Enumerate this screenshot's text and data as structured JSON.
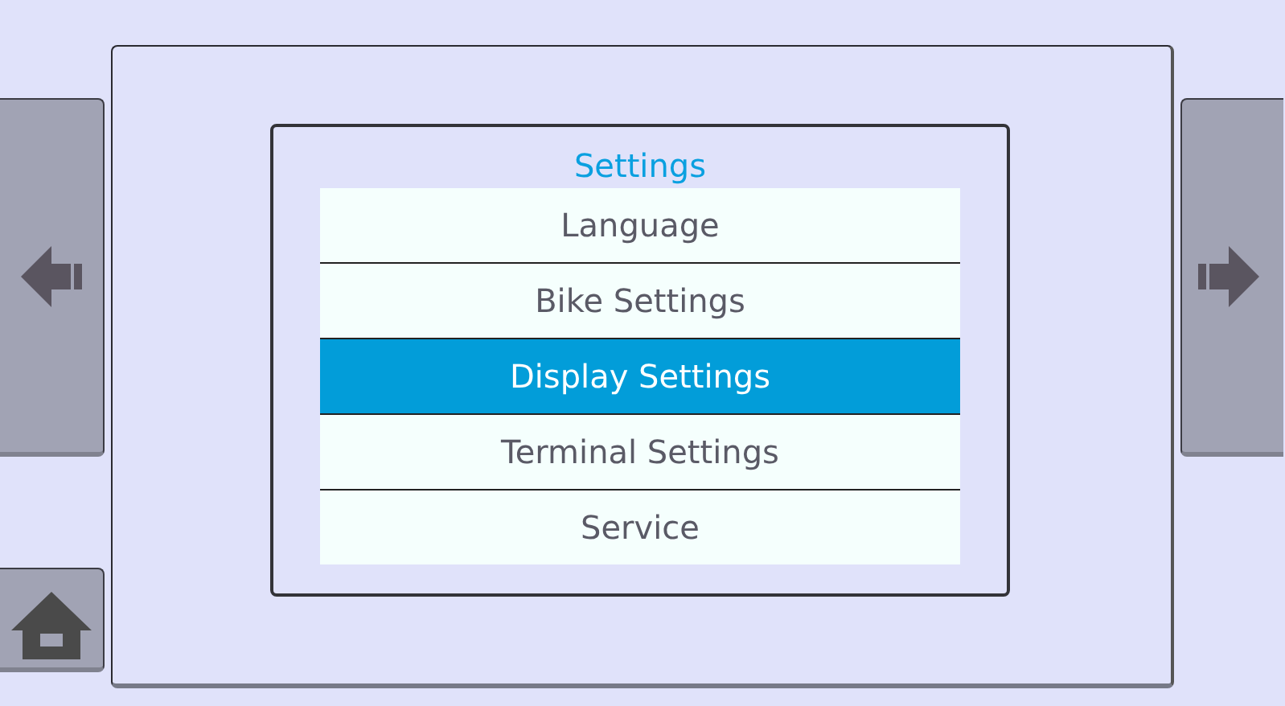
{
  "title": "Settings",
  "menu": [
    {
      "label": "Language",
      "selected": false
    },
    {
      "label": "Bike Settings",
      "selected": false
    },
    {
      "label": "Display Settings",
      "selected": true
    },
    {
      "label": "Terminal Settings",
      "selected": false
    },
    {
      "label": "Service",
      "selected": false
    }
  ]
}
